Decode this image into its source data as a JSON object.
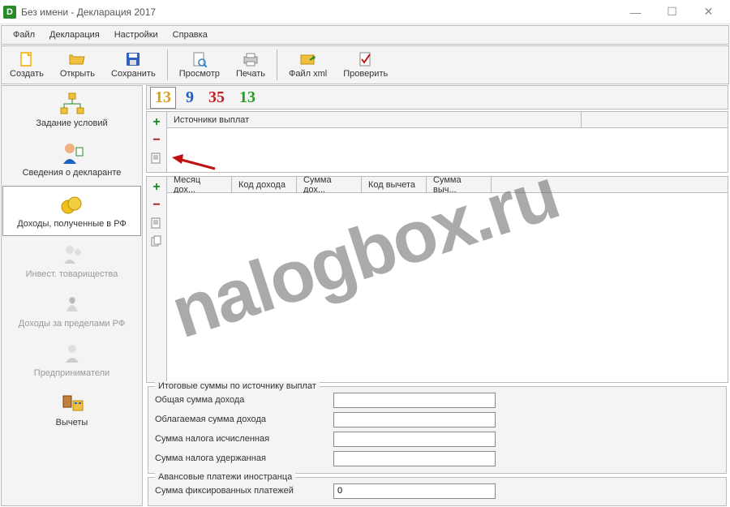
{
  "window": {
    "title": "Без имени - Декларация 2017",
    "app_icon_letter": "D"
  },
  "menu": {
    "file": "Файл",
    "declaration": "Декларация",
    "settings": "Настройки",
    "help": "Справка"
  },
  "toolbar": {
    "create": "Создать",
    "open": "Открыть",
    "save": "Сохранить",
    "view": "Просмотр",
    "print": "Печать",
    "filexml": "Файл xml",
    "check": "Проверить"
  },
  "sidebar": {
    "conditions": "Задание условий",
    "declarant": "Сведения о декларанте",
    "income_rf": "Доходы, полученные в РФ",
    "invest": "Инвест. товарищества",
    "foreign": "Доходы за пределами РФ",
    "entrepreneur": "Предприниматели",
    "deductions": "Вычеты"
  },
  "rates": {
    "r13a": "13",
    "r9": "9",
    "r35": "35",
    "r13b": "13"
  },
  "sources": {
    "header": "Источники выплат"
  },
  "months": {
    "col_month": "Месяц дох...",
    "col_code_income": "Код дохода",
    "col_sum_income": "Сумма дох...",
    "col_code_deduct": "Код вычета",
    "col_sum_deduct": "Сумма выч..."
  },
  "totals": {
    "legend": "Итоговые суммы по источнику выплат",
    "total_income_label": "Общая сумма дохода",
    "taxable_income_label": "Облагаемая сумма дохода",
    "tax_calc_label": "Сумма налога исчисленная",
    "tax_withheld_label": "Сумма налога удержанная",
    "total_income_value": "",
    "taxable_income_value": "",
    "tax_calc_value": "",
    "tax_withheld_value": ""
  },
  "advance": {
    "legend": "Авансовые платежи иностранца",
    "fixed_label": "Сумма фиксированных платежей",
    "fixed_value": "0"
  },
  "watermark": "nalogbox.ru"
}
